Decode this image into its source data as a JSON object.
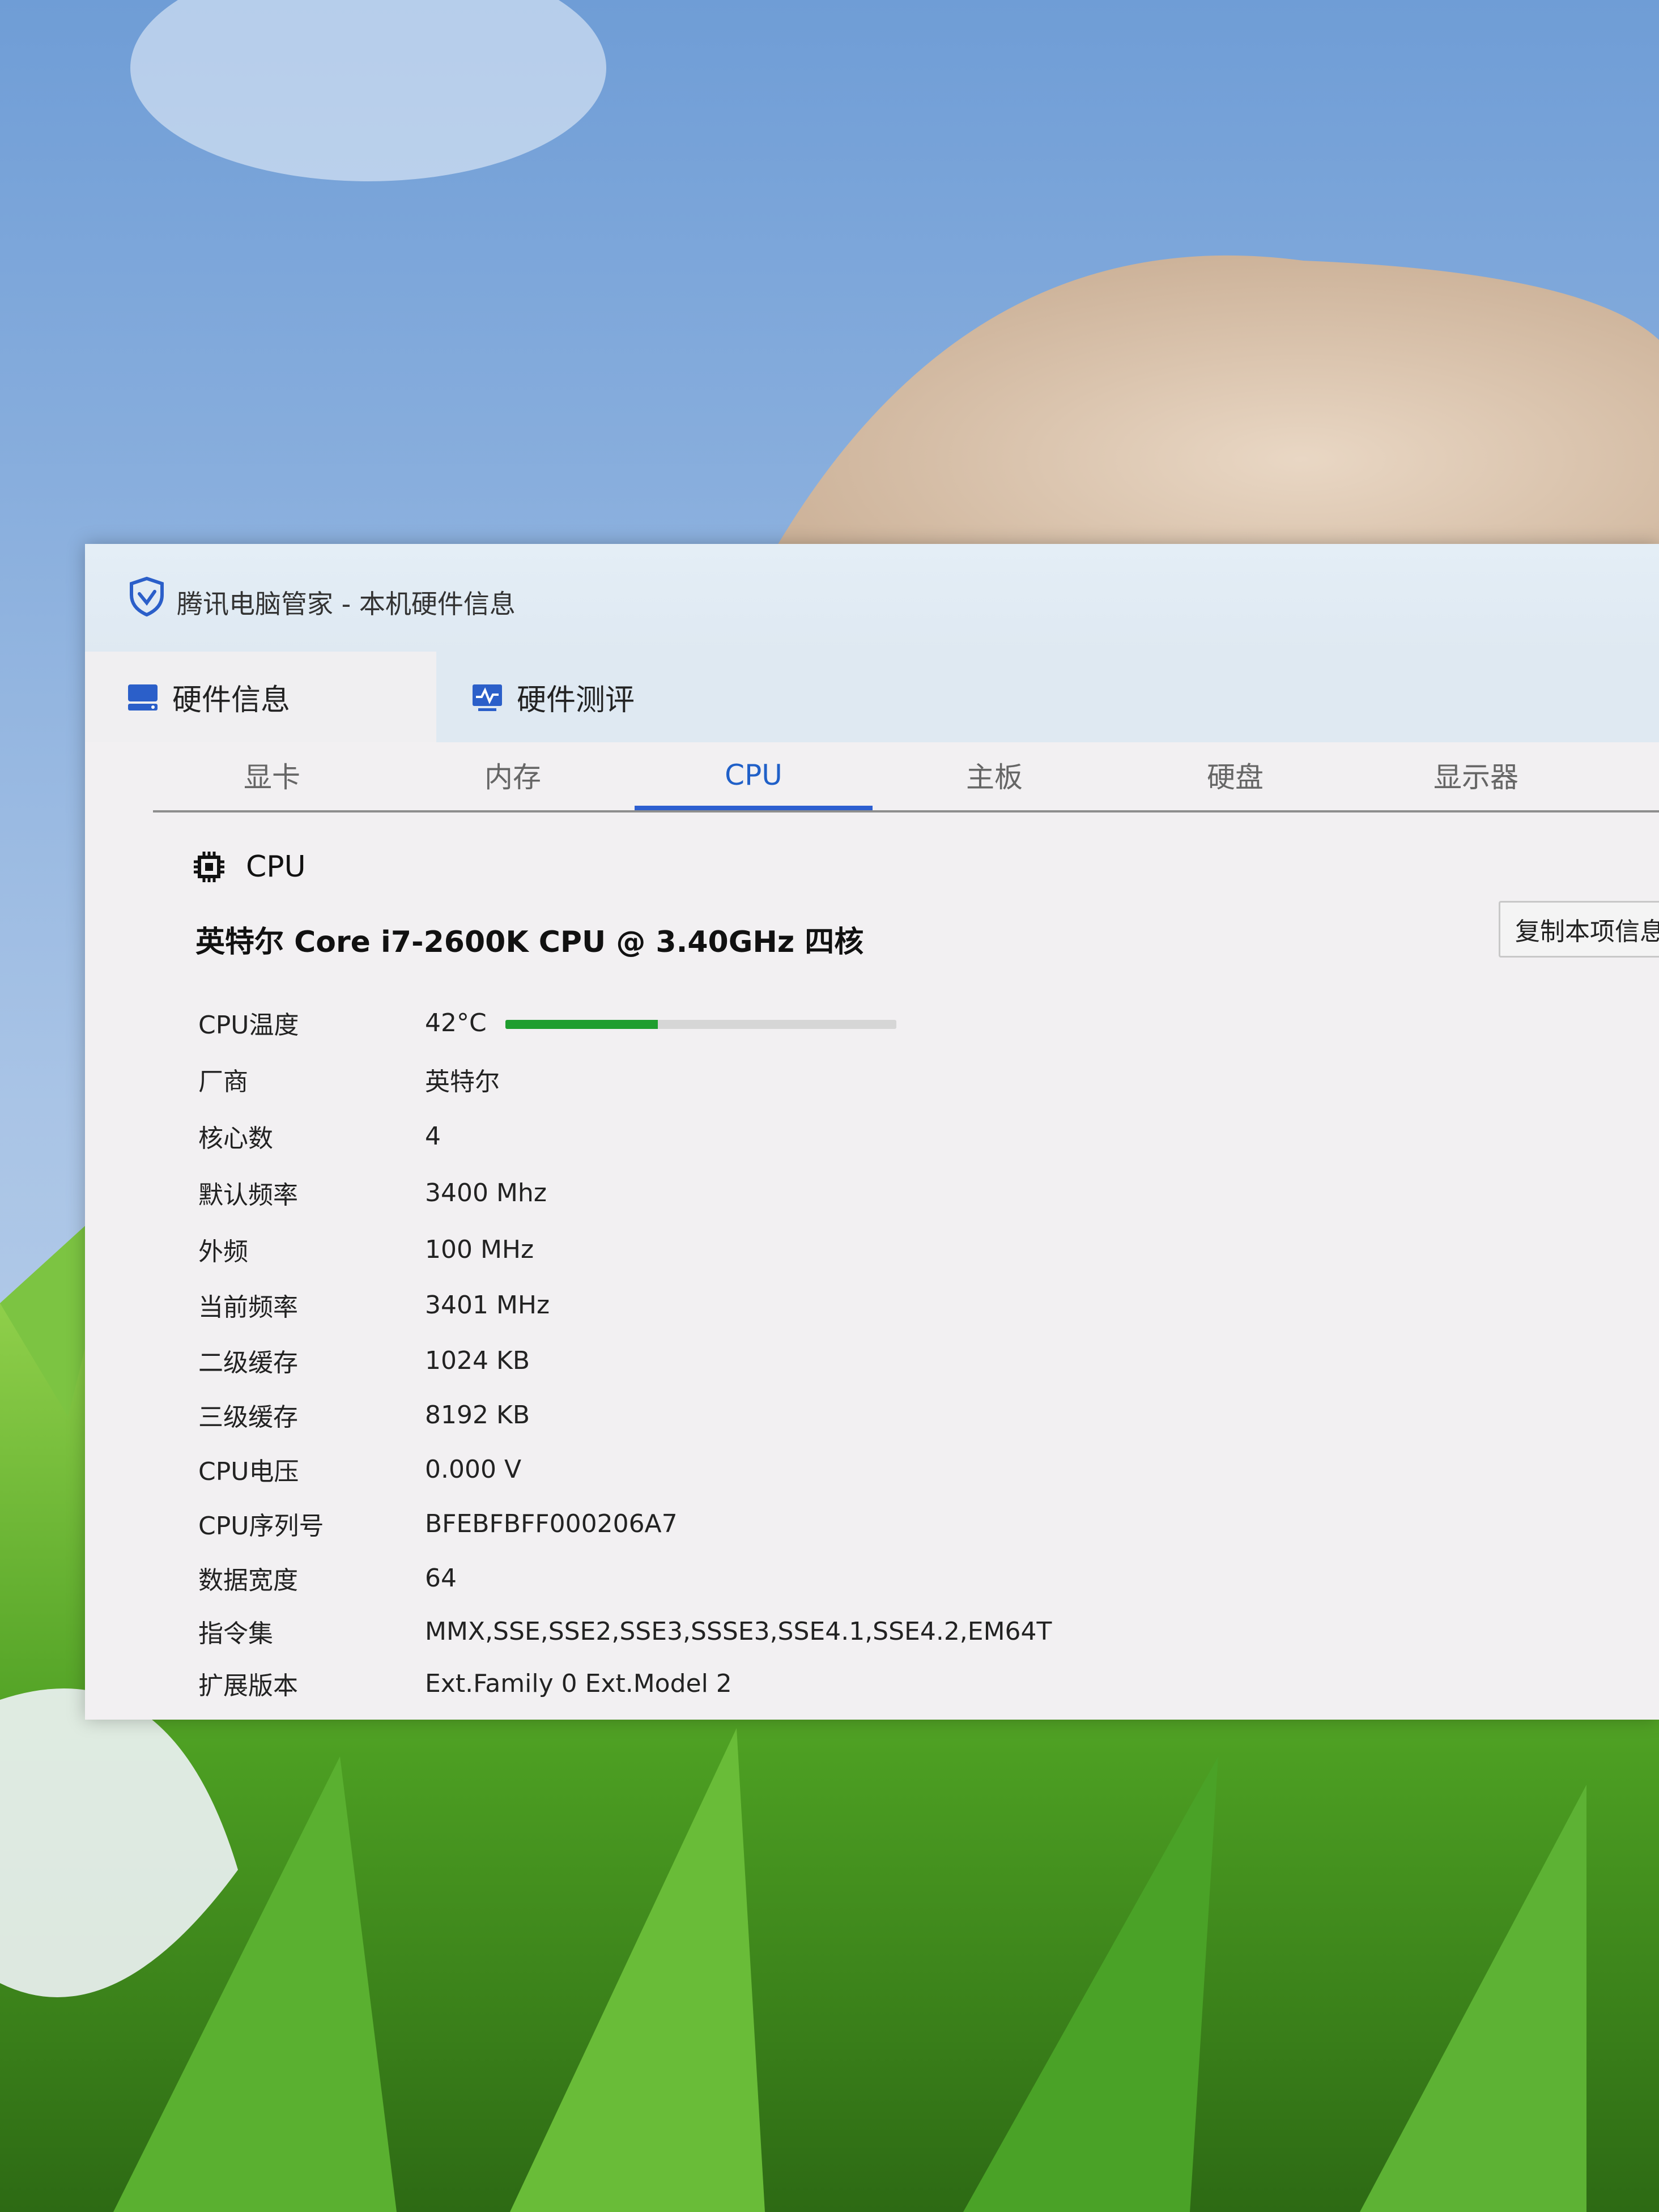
{
  "window": {
    "title": "腾讯电脑管家 - 本机硬件信息"
  },
  "main_tabs": [
    {
      "label": "硬件信息",
      "icon": "hardware-info-icon",
      "active": true
    },
    {
      "label": "硬件测评",
      "icon": "benchmark-icon",
      "active": false
    }
  ],
  "sub_tabs": [
    {
      "label": "显卡",
      "active": false
    },
    {
      "label": "内存",
      "active": false
    },
    {
      "label": "CPU",
      "active": true
    },
    {
      "label": "主板",
      "active": false
    },
    {
      "label": "硬盘",
      "active": false
    },
    {
      "label": "显示器",
      "active": false
    }
  ],
  "cpu": {
    "section_title": "CPU",
    "model_name": "英特尔 Core i7-2600K CPU @ 3.40GHz 四核",
    "copy_button": "复制本项信息",
    "temperature_fraction": 0.39,
    "rows": [
      {
        "label": "CPU温度",
        "value": "42°C"
      },
      {
        "label": "厂商",
        "value": "英特尔"
      },
      {
        "label": "核心数",
        "value": "4"
      },
      {
        "label": "默认频率",
        "value": "3400 Mhz"
      },
      {
        "label": "外频",
        "value": "100 MHz"
      },
      {
        "label": "当前频率",
        "value": "3401 MHz"
      },
      {
        "label": "二级缓存",
        "value": "1024 KB"
      },
      {
        "label": "三级缓存",
        "value": "8192 KB"
      },
      {
        "label": "CPU电压",
        "value": "0.000 V"
      },
      {
        "label": "CPU序列号",
        "value": "BFEBFBFF000206A7"
      },
      {
        "label": "数据宽度",
        "value": "64"
      },
      {
        "label": "指令集",
        "value": "MMX,SSE,SSE2,SSE3,SSSE3,SSE4.1,SSE4.2,EM64T"
      },
      {
        "label": "扩展版本",
        "value": "Ext.Family 0  Ext.Model 2"
      }
    ]
  },
  "colors": {
    "accent": "#2d5fd0",
    "temp_bar": "#1f9e2e"
  }
}
